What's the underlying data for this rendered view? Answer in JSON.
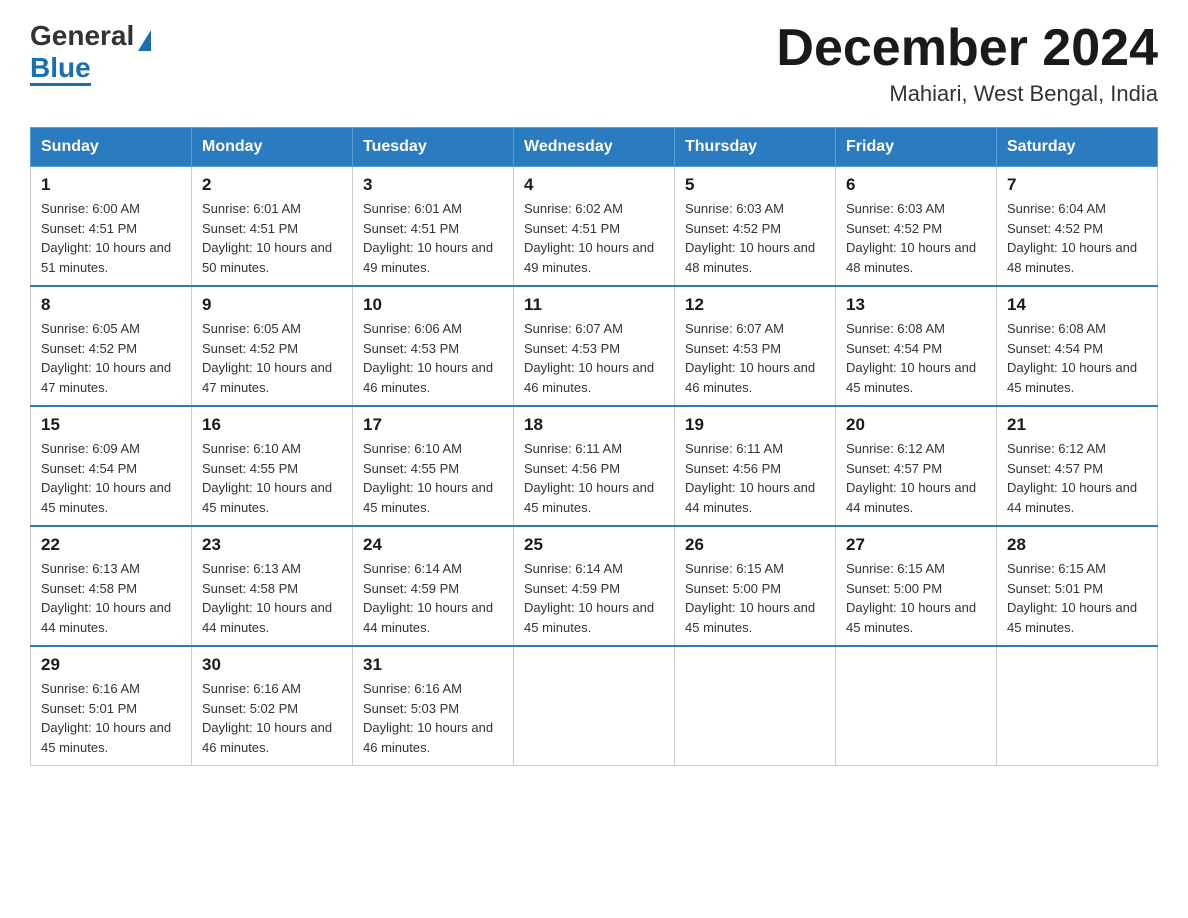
{
  "header": {
    "logo_general": "General",
    "logo_blue": "Blue",
    "month_title": "December 2024",
    "location": "Mahiari, West Bengal, India"
  },
  "days_of_week": [
    "Sunday",
    "Monday",
    "Tuesday",
    "Wednesday",
    "Thursday",
    "Friday",
    "Saturday"
  ],
  "weeks": [
    [
      {
        "day": "1",
        "sunrise": "6:00 AM",
        "sunset": "4:51 PM",
        "daylight": "10 hours and 51 minutes."
      },
      {
        "day": "2",
        "sunrise": "6:01 AM",
        "sunset": "4:51 PM",
        "daylight": "10 hours and 50 minutes."
      },
      {
        "day": "3",
        "sunrise": "6:01 AM",
        "sunset": "4:51 PM",
        "daylight": "10 hours and 49 minutes."
      },
      {
        "day": "4",
        "sunrise": "6:02 AM",
        "sunset": "4:51 PM",
        "daylight": "10 hours and 49 minutes."
      },
      {
        "day": "5",
        "sunrise": "6:03 AM",
        "sunset": "4:52 PM",
        "daylight": "10 hours and 48 minutes."
      },
      {
        "day": "6",
        "sunrise": "6:03 AM",
        "sunset": "4:52 PM",
        "daylight": "10 hours and 48 minutes."
      },
      {
        "day": "7",
        "sunrise": "6:04 AM",
        "sunset": "4:52 PM",
        "daylight": "10 hours and 48 minutes."
      }
    ],
    [
      {
        "day": "8",
        "sunrise": "6:05 AM",
        "sunset": "4:52 PM",
        "daylight": "10 hours and 47 minutes."
      },
      {
        "day": "9",
        "sunrise": "6:05 AM",
        "sunset": "4:52 PM",
        "daylight": "10 hours and 47 minutes."
      },
      {
        "day": "10",
        "sunrise": "6:06 AM",
        "sunset": "4:53 PM",
        "daylight": "10 hours and 46 minutes."
      },
      {
        "day": "11",
        "sunrise": "6:07 AM",
        "sunset": "4:53 PM",
        "daylight": "10 hours and 46 minutes."
      },
      {
        "day": "12",
        "sunrise": "6:07 AM",
        "sunset": "4:53 PM",
        "daylight": "10 hours and 46 minutes."
      },
      {
        "day": "13",
        "sunrise": "6:08 AM",
        "sunset": "4:54 PM",
        "daylight": "10 hours and 45 minutes."
      },
      {
        "day": "14",
        "sunrise": "6:08 AM",
        "sunset": "4:54 PM",
        "daylight": "10 hours and 45 minutes."
      }
    ],
    [
      {
        "day": "15",
        "sunrise": "6:09 AM",
        "sunset": "4:54 PM",
        "daylight": "10 hours and 45 minutes."
      },
      {
        "day": "16",
        "sunrise": "6:10 AM",
        "sunset": "4:55 PM",
        "daylight": "10 hours and 45 minutes."
      },
      {
        "day": "17",
        "sunrise": "6:10 AM",
        "sunset": "4:55 PM",
        "daylight": "10 hours and 45 minutes."
      },
      {
        "day": "18",
        "sunrise": "6:11 AM",
        "sunset": "4:56 PM",
        "daylight": "10 hours and 45 minutes."
      },
      {
        "day": "19",
        "sunrise": "6:11 AM",
        "sunset": "4:56 PM",
        "daylight": "10 hours and 44 minutes."
      },
      {
        "day": "20",
        "sunrise": "6:12 AM",
        "sunset": "4:57 PM",
        "daylight": "10 hours and 44 minutes."
      },
      {
        "day": "21",
        "sunrise": "6:12 AM",
        "sunset": "4:57 PM",
        "daylight": "10 hours and 44 minutes."
      }
    ],
    [
      {
        "day": "22",
        "sunrise": "6:13 AM",
        "sunset": "4:58 PM",
        "daylight": "10 hours and 44 minutes."
      },
      {
        "day": "23",
        "sunrise": "6:13 AM",
        "sunset": "4:58 PM",
        "daylight": "10 hours and 44 minutes."
      },
      {
        "day": "24",
        "sunrise": "6:14 AM",
        "sunset": "4:59 PM",
        "daylight": "10 hours and 44 minutes."
      },
      {
        "day": "25",
        "sunrise": "6:14 AM",
        "sunset": "4:59 PM",
        "daylight": "10 hours and 45 minutes."
      },
      {
        "day": "26",
        "sunrise": "6:15 AM",
        "sunset": "5:00 PM",
        "daylight": "10 hours and 45 minutes."
      },
      {
        "day": "27",
        "sunrise": "6:15 AM",
        "sunset": "5:00 PM",
        "daylight": "10 hours and 45 minutes."
      },
      {
        "day": "28",
        "sunrise": "6:15 AM",
        "sunset": "5:01 PM",
        "daylight": "10 hours and 45 minutes."
      }
    ],
    [
      {
        "day": "29",
        "sunrise": "6:16 AM",
        "sunset": "5:01 PM",
        "daylight": "10 hours and 45 minutes."
      },
      {
        "day": "30",
        "sunrise": "6:16 AM",
        "sunset": "5:02 PM",
        "daylight": "10 hours and 46 minutes."
      },
      {
        "day": "31",
        "sunrise": "6:16 AM",
        "sunset": "5:03 PM",
        "daylight": "10 hours and 46 minutes."
      },
      null,
      null,
      null,
      null
    ]
  ],
  "labels": {
    "sunrise": "Sunrise:",
    "sunset": "Sunset:",
    "daylight": "Daylight:"
  }
}
